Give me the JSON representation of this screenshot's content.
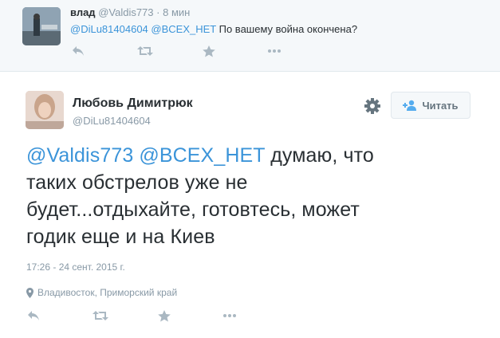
{
  "reply_tweet": {
    "author_name": "влад",
    "author_handle": "@Valdis773",
    "separator": "·",
    "time_ago": "8 мин",
    "mention_1": "@DiLu81404604",
    "mention_2": "@BCEX_HET",
    "text": "По вашему война окончена?",
    "actions": [
      "reply-icon",
      "retweet-icon",
      "favorite-icon",
      "more-icon"
    ]
  },
  "main_tweet": {
    "author_name": "Любовь Димитрюк",
    "author_handle": "@DiLu81404604",
    "follow_label": "Читать",
    "mention_1": "@Valdis773",
    "mention_2": "@BCEX_HET",
    "text": "думаю, что таких обстрелов уже не будет...отдыхайте, готовтесь, может годик еще и на Киев",
    "timestamp": "17:26 - 24 сент. 2015 г.",
    "location": "Владивосток, Приморский край",
    "actions": [
      "reply-icon",
      "retweet-icon",
      "favorite-icon",
      "more-icon"
    ]
  },
  "colors": {
    "link": "#3b94d9",
    "muted": "#8899a6",
    "text": "#292f33",
    "header_bg": "#f5f8fa"
  }
}
